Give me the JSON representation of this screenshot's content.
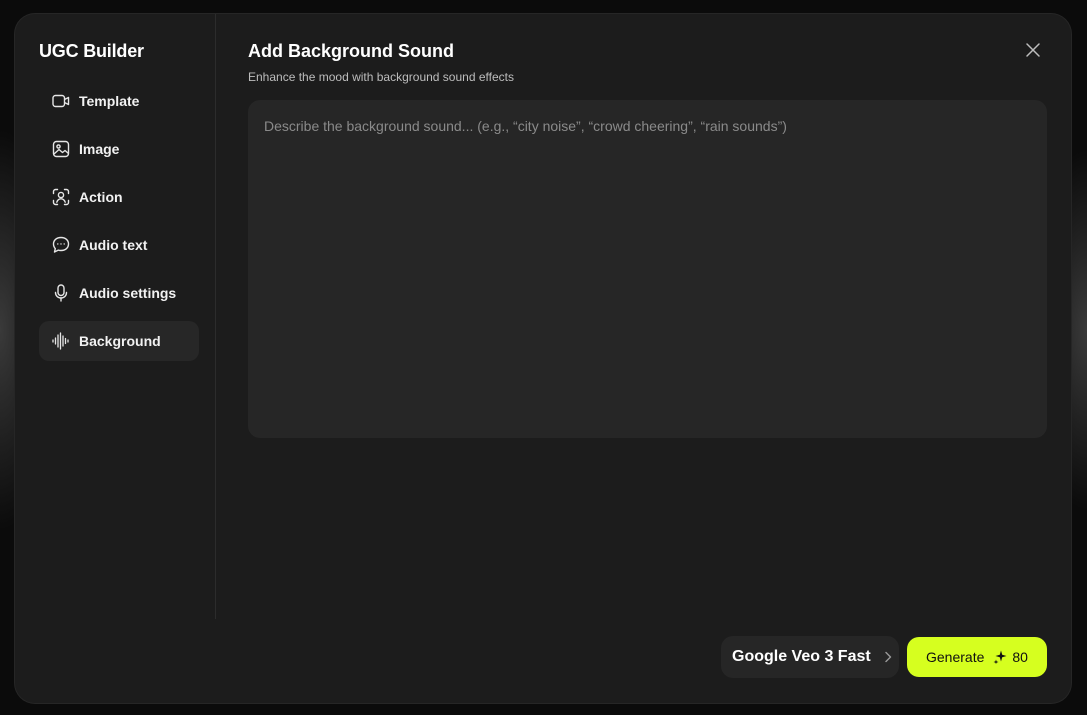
{
  "sidebar": {
    "title": "UGC Builder",
    "items": [
      {
        "label": "Template",
        "icon": "video-camera-icon",
        "active": false
      },
      {
        "label": "Image",
        "icon": "image-icon",
        "active": false
      },
      {
        "label": "Action",
        "icon": "person-focus-icon",
        "active": false
      },
      {
        "label": "Audio text",
        "icon": "chat-bubble-icon",
        "active": false
      },
      {
        "label": "Audio settings",
        "icon": "microphone-icon",
        "active": false
      },
      {
        "label": "Background",
        "icon": "audio-waveform-icon",
        "active": true
      }
    ]
  },
  "main": {
    "title": "Add Background Sound",
    "subtitle": "Enhance the mood with background sound effects",
    "prompt": {
      "value": "",
      "placeholder": "Describe the background sound... (e.g., “city noise”, “crowd cheering”, “rain sounds”)"
    }
  },
  "footer": {
    "model_label": "Google Veo 3 Fast",
    "generate_label": "Generate",
    "credit_cost": "80"
  },
  "colors": {
    "modal_bg": "#1c1c1c",
    "input_bg": "#262626",
    "accent": "#d6ff1f",
    "active_nav_bg": "#272727"
  }
}
